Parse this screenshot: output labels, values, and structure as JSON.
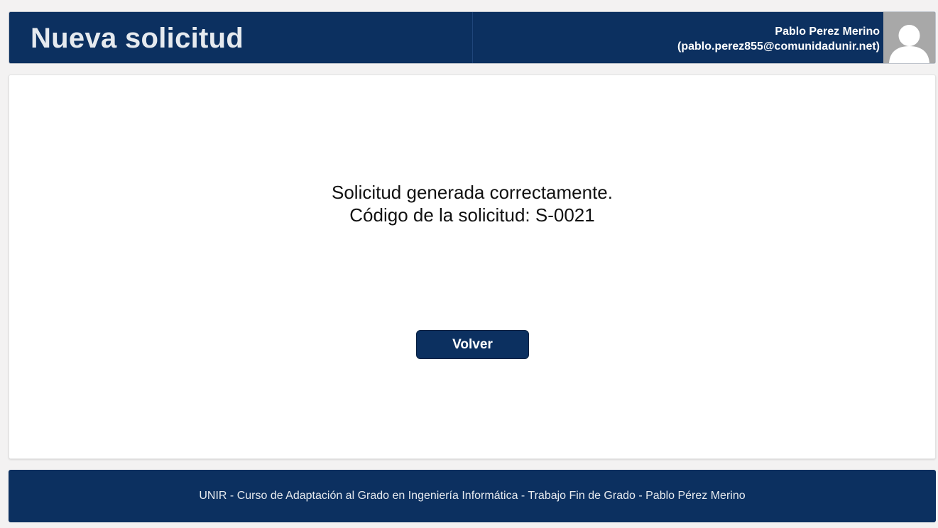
{
  "header": {
    "title": "Nueva solicitud",
    "user_name": "Pablo Perez Merino",
    "user_email": "(pablo.perez855@comunidadunir.net)",
    "avatar_icon": "user-silhouette-icon"
  },
  "main": {
    "message_line1": "Solicitud generada correctamente.",
    "message_line2": "Código de la solicitud: S-0021",
    "back_button_label": "Volver"
  },
  "footer": {
    "text": "UNIR - Curso de Adaptación al Grado en Ingeniería Informática - Trabajo Fin de Grado - Pablo Pérez Merino"
  },
  "colors": {
    "primary": "#0c3060",
    "background": "#f3f2f2",
    "card": "#ffffff",
    "avatar_bg": "#a8a8a8"
  }
}
